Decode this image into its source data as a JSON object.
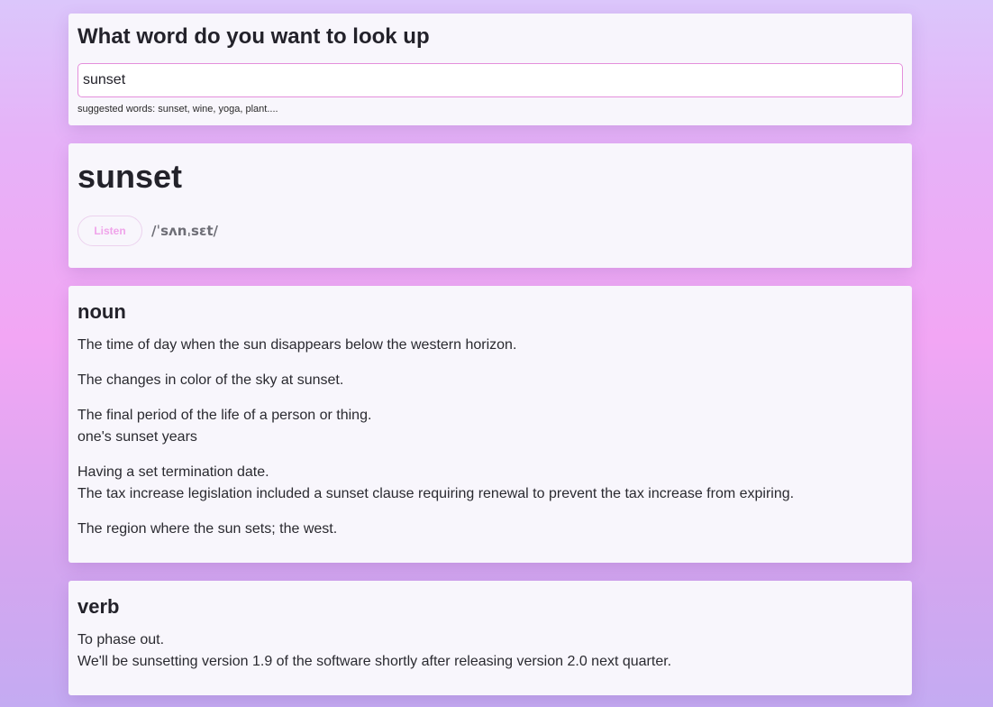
{
  "search": {
    "title": "What word do you want to look up",
    "value": "sunset",
    "placeholder": "",
    "suggestions": "suggested words: sunset, wine, yoga, plant...."
  },
  "word": {
    "title": "sunset",
    "listen_label": "Listen",
    "phonetic": "/ˈsʌnˌsɛt/"
  },
  "meanings": [
    {
      "part_of_speech": "noun",
      "definitions": [
        {
          "text": "The time of day when the sun disappears below the western horizon.",
          "example": ""
        },
        {
          "text": "The changes in color of the sky at sunset.",
          "example": ""
        },
        {
          "text": "The final period of the life of a person or thing.",
          "example": "one's sunset years"
        },
        {
          "text": "Having a set termination date.",
          "example": "The tax increase legislation included a sunset clause requiring renewal to prevent the tax increase from expiring."
        },
        {
          "text": "The region where the sun sets; the west.",
          "example": ""
        }
      ]
    },
    {
      "part_of_speech": "verb",
      "definitions": [
        {
          "text": "To phase out.",
          "example": "We'll be sunsetting version 1.9 of the software shortly after releasing version 2.0 next quarter."
        }
      ]
    }
  ],
  "colors": {
    "accent": "#e48fdc",
    "listen_text": "#f0a4ea",
    "card_background": "#f8f6fc"
  }
}
